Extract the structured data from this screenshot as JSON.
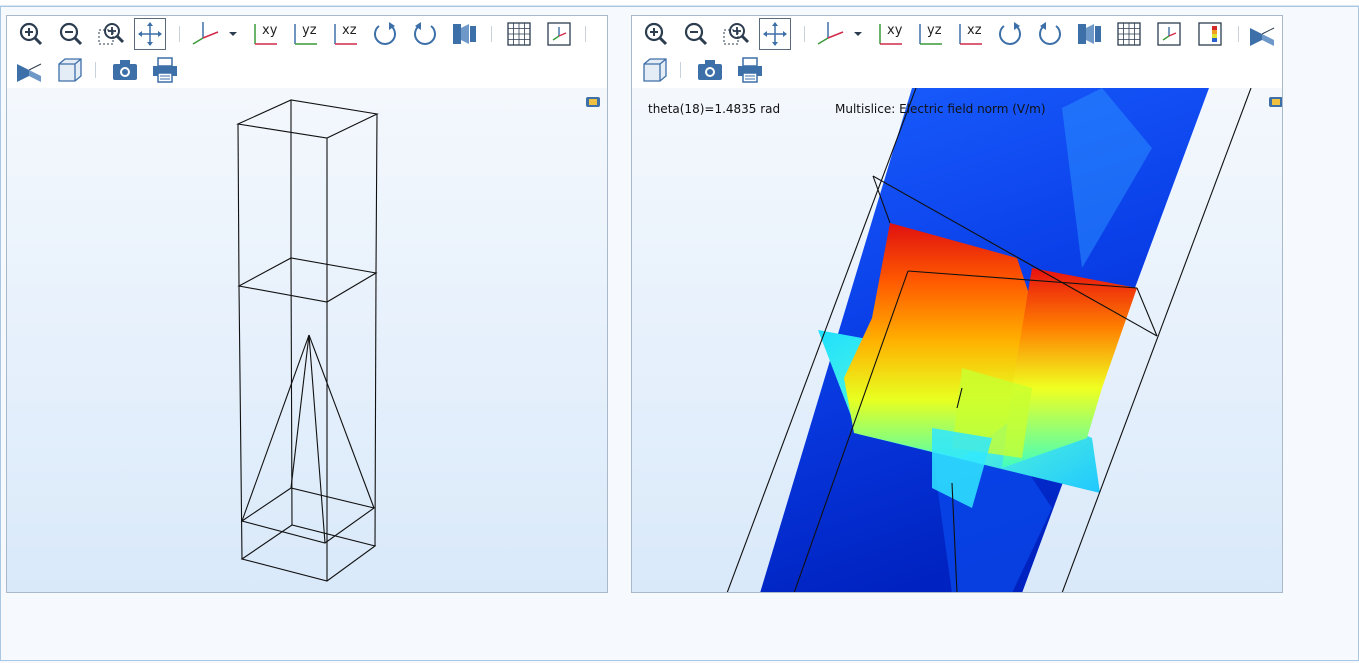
{
  "left_view": {
    "toolbar": {
      "zoom_in": "zoom-in-icon",
      "zoom_out": "zoom-out-icon",
      "zoom_box": "zoom-box-icon",
      "zoom_extents": "zoom-extents-icon",
      "go_to_default_view": "axes-view-icon",
      "xy": "xy",
      "yz": "yz",
      "xz": "xz",
      "rotate_cw": "rotate-cw-icon",
      "rotate_ccw": "rotate-ccw-icon",
      "scene_light": "scene-light-icon",
      "grid": "grid-icon",
      "axis_orientation": "axis-orientation-icon",
      "transparency": "transparency-icon",
      "wireframe": "wireframe-box-icon",
      "camera": "camera-icon",
      "print": "print-icon"
    }
  },
  "right_view": {
    "toolbar": {
      "zoom_in": "zoom-in-icon",
      "zoom_out": "zoom-out-icon",
      "zoom_box": "zoom-box-icon",
      "zoom_extents": "zoom-extents-icon",
      "go_to_default_view": "axes-view-icon",
      "xy": "xy",
      "yz": "yz",
      "xz": "xz",
      "rotate_cw": "rotate-cw-icon",
      "rotate_ccw": "rotate-ccw-icon",
      "scene_light": "scene-light-icon",
      "grid": "grid-icon",
      "axis_orientation": "axis-orientation-icon",
      "color_legend": "color-legend-icon",
      "transparency": "transparency-icon",
      "wireframe": "wireframe-box-icon",
      "camera": "camera-icon",
      "print": "print-icon"
    },
    "parameter_label": "theta(18)=1.4835 rad",
    "plot_label": "Multislice: Electric field norm (V/m)"
  },
  "colors": {
    "icon_blue": "#3d6fa8",
    "icon_dark": "#2d3d50",
    "axis_green": "#3a9a3a",
    "axis_red": "#d22a4a",
    "canvas_top": "#f4f8fd",
    "canvas_bottom": "#d9e9fa"
  }
}
